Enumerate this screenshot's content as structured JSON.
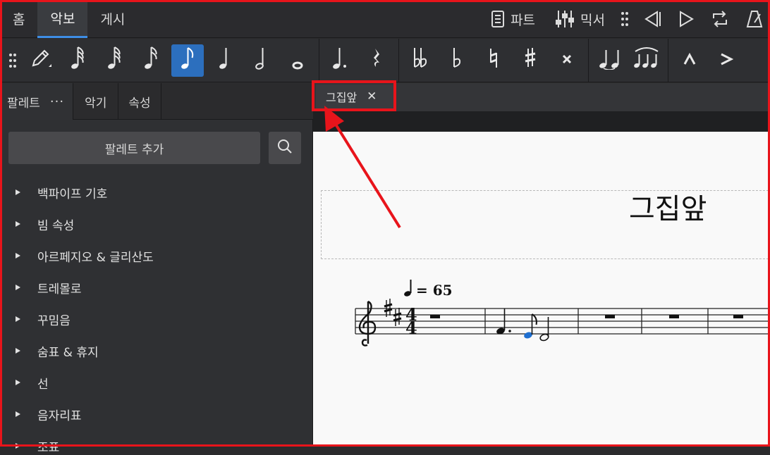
{
  "top_tabs": [
    {
      "label": "홈",
      "active": false
    },
    {
      "label": "악보",
      "active": true
    },
    {
      "label": "게시",
      "active": false
    }
  ],
  "top_right": {
    "parts_label": "파트",
    "mixer_label": "믹서"
  },
  "left_tabs": {
    "palette": "팔레트",
    "more": "···",
    "instruments": "악기",
    "properties": "속성"
  },
  "palette_panel": {
    "add_palette_label": "팔레트 추가",
    "items": [
      "백파이프 기호",
      "빔 속성",
      "아르페지오 & 글리산도",
      "트레몰로",
      "꾸밈음",
      "숨표 & 휴지",
      "선",
      "음자리표",
      "조표"
    ]
  },
  "document_tab": {
    "title": "그집앞",
    "close": "✕"
  },
  "score": {
    "title": "그집앞",
    "tempo_value": "= 65",
    "time_signature": [
      "4",
      "4"
    ]
  },
  "colors": {
    "accent": "#2c6fbe",
    "highlight_red": "#e8141b",
    "selected_note": "#1f6fd0"
  }
}
